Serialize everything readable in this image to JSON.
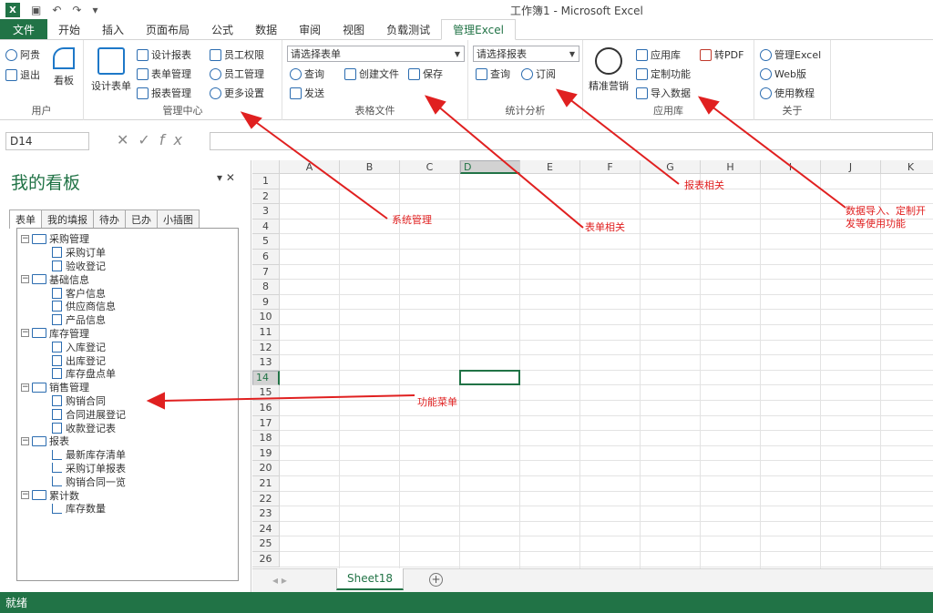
{
  "window": {
    "title": "工作簿1 - Microsoft Excel",
    "logo": "X"
  },
  "tabs": [
    "文件",
    "开始",
    "插入",
    "页面布局",
    "公式",
    "数据",
    "审阅",
    "视图",
    "负载测试",
    "管理Excel"
  ],
  "ribbon": {
    "user": {
      "label": "用户",
      "items": [
        "阿贵",
        "退出"
      ],
      "big": "看板"
    },
    "mgmt": {
      "label": "管理中心",
      "big": "设计表单",
      "col1": [
        "设计报表",
        "表单管理",
        "报表管理"
      ],
      "col2": [
        "员工权限",
        "员工管理",
        "更多设置"
      ]
    },
    "form": {
      "label": "表格文件",
      "select": "请选择表单",
      "row1": [
        "查询",
        "创建文件",
        "保存"
      ],
      "row2": [
        "发送"
      ]
    },
    "stats": {
      "label": "统计分析",
      "select": "请选择报表",
      "row1": [
        "查询",
        "订阅"
      ]
    },
    "apps": {
      "label": "应用库",
      "big": "精准营销",
      "col1": [
        "应用库",
        "定制功能",
        "导入数据"
      ],
      "col2": [
        "转PDF"
      ]
    },
    "about": {
      "label": "关于",
      "items": [
        "管理Excel",
        "Web版",
        "使用教程"
      ]
    }
  },
  "formula": {
    "namebox": "D14",
    "fx": "fx"
  },
  "panel": {
    "title": "我的看板",
    "tabs": [
      "表单",
      "我的填报",
      "待办",
      "已办",
      "小插图"
    ],
    "tree": [
      {
        "g": "采购管理",
        "c": [
          "采购订单",
          "验收登记"
        ]
      },
      {
        "g": "基础信息",
        "c": [
          "客户信息",
          "供应商信息",
          "产品信息"
        ]
      },
      {
        "g": "库存管理",
        "c": [
          "入库登记",
          "出库登记",
          "库存盘点单"
        ]
      },
      {
        "g": "销售管理",
        "c": [
          "购销合同",
          "合同进展登记",
          "收款登记表"
        ]
      },
      {
        "g": "报表",
        "c": [
          "最新库存清单",
          "采购订单报表",
          "购销合同一览"
        ]
      },
      {
        "g": "累计数",
        "c": [
          "库存数量"
        ]
      }
    ]
  },
  "grid": {
    "cols": [
      "A",
      "B",
      "C",
      "D",
      "E",
      "F",
      "G",
      "H",
      "I",
      "J",
      "K"
    ],
    "selected_col": "D",
    "selected_row": 14,
    "rows": 26
  },
  "sheet": {
    "name": "Sheet18"
  },
  "status": {
    "text": "就绪"
  },
  "annotations": {
    "sys": "系统管理",
    "form": "表单相关",
    "report": "报表相关",
    "data1": "数据导入、定制开",
    "data2": "发等使用功能",
    "menu": "功能菜单"
  }
}
